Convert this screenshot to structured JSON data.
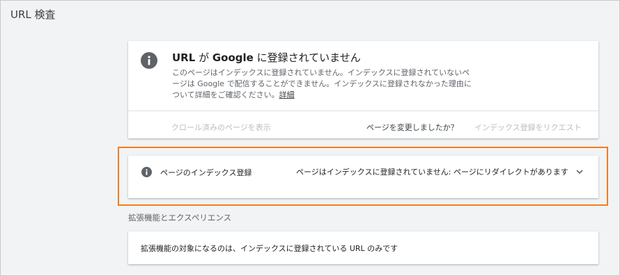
{
  "page": {
    "title": "URL 検査"
  },
  "status_card": {
    "heading_parts": [
      "URL",
      " が ",
      "Google",
      " に登録されていません"
    ],
    "description": "このページはインデックスに登録されていません。インデックスに登録されていないページは Google で配信することができません。インデックスに登録されなかった理由について詳細をご確認ください。",
    "learn_more": "詳細",
    "view_crawled_label": "クロール済みのページを表示",
    "changed_question": "ページを変更しましたか？",
    "request_index_label": "インデックス登録をリクエスト",
    "icon": "info-icon"
  },
  "coverage": {
    "label": "ページのインデックス登録",
    "value": "ページはインデックスに登録されていません: ページにリダイレクトがあります",
    "icon": "info-icon",
    "expand_icon": "chevron-down-icon"
  },
  "enhancements": {
    "heading": "拡張機能とエクスペリエンス",
    "text": "拡張機能の対象になるのは、インデックスに登録されている URL のみです"
  },
  "colors": {
    "highlight": "#f47c20",
    "icon": "#5f6368",
    "disabled": "#bdbdbd",
    "background": "#f1f3f4"
  }
}
